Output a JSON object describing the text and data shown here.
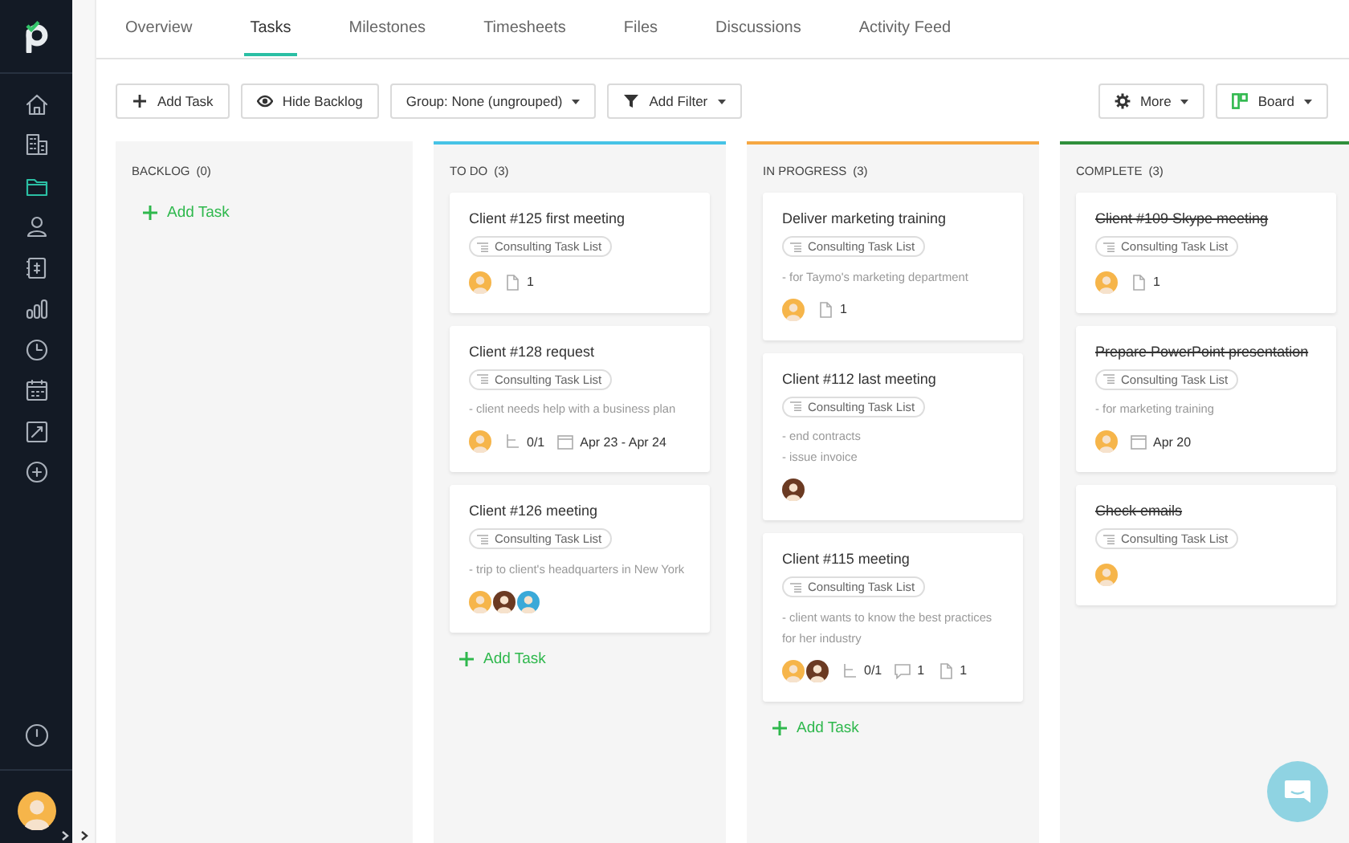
{
  "sidebar": {
    "items": [
      {
        "kind": "home",
        "selected": false
      },
      {
        "kind": "buildings",
        "selected": false
      },
      {
        "kind": "folder",
        "selected": true
      },
      {
        "kind": "person",
        "selected": false
      },
      {
        "kind": "ledger",
        "selected": false
      },
      {
        "kind": "chart",
        "selected": false
      },
      {
        "kind": "clock",
        "selected": false
      },
      {
        "kind": "calendar",
        "selected": false
      },
      {
        "kind": "report",
        "selected": false
      },
      {
        "kind": "plus",
        "selected": false
      }
    ],
    "bottom_items": [
      {
        "kind": "alert",
        "selected": false
      }
    ],
    "user_avatar": {
      "color": "#f6b54a"
    }
  },
  "tabs": [
    {
      "label": "Overview",
      "selected": false
    },
    {
      "label": "Tasks",
      "selected": true
    },
    {
      "label": "Milestones",
      "selected": false
    },
    {
      "label": "Timesheets",
      "selected": false
    },
    {
      "label": "Files",
      "selected": false
    },
    {
      "label": "Discussions",
      "selected": false
    },
    {
      "label": "Activity Feed",
      "selected": false
    }
  ],
  "toolbar": {
    "left": [
      {
        "label": "Add Task",
        "kind": "plus",
        "caret": false
      },
      {
        "label": "Hide Backlog",
        "kind": "eye",
        "caret": false
      },
      {
        "label": "Group: None (ungrouped)",
        "kind": "none",
        "caret": true
      },
      {
        "label": "Add Filter",
        "kind": "filter",
        "caret": true
      }
    ],
    "right": [
      {
        "label": "More",
        "kind": "gear",
        "caret": true
      },
      {
        "label": "Board",
        "kind": "board",
        "caret": true
      }
    ]
  },
  "columns": [
    {
      "title": "BACKLOG",
      "count": "(0)",
      "add_label": "Add Task"
    },
    {
      "title": "TO DO",
      "count": "(3)",
      "color": "#46c3e6",
      "add_label": "Add Task",
      "cards": [
        {
          "title": "Client #125 first meeting",
          "list": "Consulting Task List",
          "done": false,
          "avatars": [
            {
              "color": "#f6b54a"
            }
          ],
          "meta": [
            {
              "kind": "files",
              "text": "1"
            }
          ]
        },
        {
          "title": "Client #128 request",
          "list": "Consulting Task List",
          "done": false,
          "notes": [
            "- client needs help with a business plan"
          ],
          "avatars": [
            {
              "color": "#f6b54a"
            }
          ],
          "meta": [
            {
              "kind": "subtasks",
              "text": "0/1"
            },
            {
              "kind": "date",
              "text": "Apr 23 - Apr 24"
            }
          ]
        },
        {
          "title": "Client #126 meeting",
          "list": "Consulting Task List",
          "done": false,
          "notes": [
            "- trip to client's headquarters in New York"
          ],
          "avatars": [
            {
              "color": "#f6b54a"
            },
            {
              "color": "#6b3a22"
            },
            {
              "color": "#3aa9d8"
            }
          ]
        }
      ]
    },
    {
      "title": "IN PROGRESS",
      "count": "(3)",
      "color": "#f5a742",
      "add_label": "Add Task",
      "cards": [
        {
          "title": "Deliver marketing training",
          "list": "Consulting Task List",
          "done": false,
          "notes": [
            "- for Taymo's marketing department"
          ],
          "avatars": [
            {
              "color": "#f6b54a"
            }
          ],
          "meta": [
            {
              "kind": "files",
              "text": "1"
            }
          ]
        },
        {
          "title": "Client #112 last meeting",
          "list": "Consulting Task List",
          "done": false,
          "notes": [
            "- end contracts",
            "- issue invoice"
          ],
          "avatars": [
            {
              "color": "#6b3a22"
            }
          ]
        },
        {
          "title": "Client #115 meeting",
          "list": "Consulting Task List",
          "done": false,
          "notes": [
            "- client wants to know the best practices for her industry"
          ],
          "avatars": [
            {
              "color": "#f6b54a"
            },
            {
              "color": "#6b3a22"
            }
          ],
          "meta": [
            {
              "kind": "subtasks",
              "text": "0/1"
            },
            {
              "kind": "comments",
              "text": "1"
            },
            {
              "kind": "files",
              "text": "1"
            }
          ]
        }
      ]
    },
    {
      "title": "COMPLETE",
      "count": "(3)",
      "color": "#2f8f3c",
      "cards": [
        {
          "title": "Client #109 Skype meeting",
          "list": "Consulting Task List",
          "done": true,
          "avatars": [
            {
              "color": "#f6b54a"
            }
          ],
          "meta": [
            {
              "kind": "files",
              "text": "1"
            }
          ]
        },
        {
          "title": "Prepare PowerPoint presentation",
          "list": "Consulting Task List",
          "done": true,
          "notes": [
            "- for marketing training"
          ],
          "avatars": [
            {
              "color": "#f6b54a"
            }
          ],
          "meta": [
            {
              "kind": "date",
              "text": "Apr 20"
            }
          ]
        },
        {
          "title": "Check emails",
          "list": "Consulting Task List",
          "done": true,
          "avatars": [
            {
              "color": "#f6b54a"
            }
          ]
        }
      ]
    }
  ]
}
